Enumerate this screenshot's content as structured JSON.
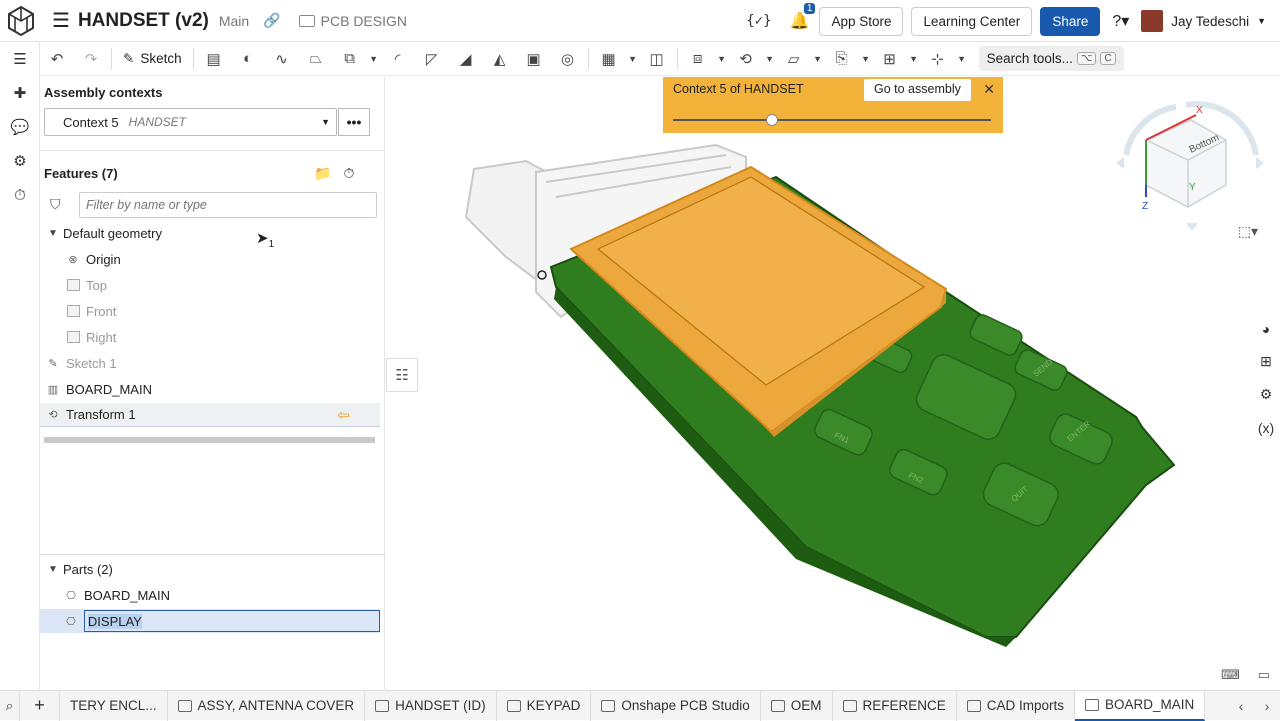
{
  "header": {
    "doc_title": "HANDSET (v2)",
    "branch": "Main",
    "folder": "PCB DESIGN",
    "vars_icon_text": "{✓}",
    "notification_count": "1",
    "app_store": "App Store",
    "learning_center": "Learning Center",
    "share": "Share",
    "user_name": "Jay Tedeschi"
  },
  "toolbar": {
    "sketch_label": "Sketch",
    "search_label": "Search tools...",
    "search_kbd1": "⌥",
    "search_kbd2": "C"
  },
  "panel": {
    "contexts_title": "Assembly contexts",
    "context_value": "Context 5",
    "context_sub": "HANDSET",
    "features_title": "Features (7)",
    "filter_placeholder": "Filter by name or type",
    "tree": {
      "default_geometry": "Default geometry",
      "origin": "Origin",
      "top": "Top",
      "front": "Front",
      "right": "Right",
      "sketch1": "Sketch 1",
      "board_main": "BOARD_MAIN",
      "transform1": "Transform 1"
    },
    "parts_title": "Parts (2)",
    "parts": {
      "board_main": "BOARD_MAIN",
      "display": "DISPLAY"
    },
    "cursor_badge": "1"
  },
  "viewport": {
    "banner_text": "Context 5 of HANDSET",
    "goto_label": "Go to assembly",
    "slider_fraction": 0.31,
    "view_cube": {
      "face_label": "Bottom",
      "axis_x": "X",
      "axis_y": "Y",
      "axis_z": "Z"
    },
    "keypad_labels": {
      "f1": "FN1",
      "f2": "FN2",
      "send": "SEND",
      "enter": "ENTER",
      "quit": "QUIT"
    }
  },
  "tabs": [
    {
      "label": "TERY ENCL..."
    },
    {
      "label": "ASSY, ANTENNA COVER"
    },
    {
      "label": "HANDSET (ID)"
    },
    {
      "label": "KEYPAD"
    },
    {
      "label": "Onshape PCB Studio"
    },
    {
      "label": "OEM"
    },
    {
      "label": "REFERENCE"
    },
    {
      "label": "CAD Imports"
    },
    {
      "label": "BOARD_MAIN"
    }
  ],
  "colors": {
    "accent": "#1859ad",
    "banner": "#f3b33b",
    "pcb": "#2f7d1e",
    "display": "#eda83d"
  }
}
